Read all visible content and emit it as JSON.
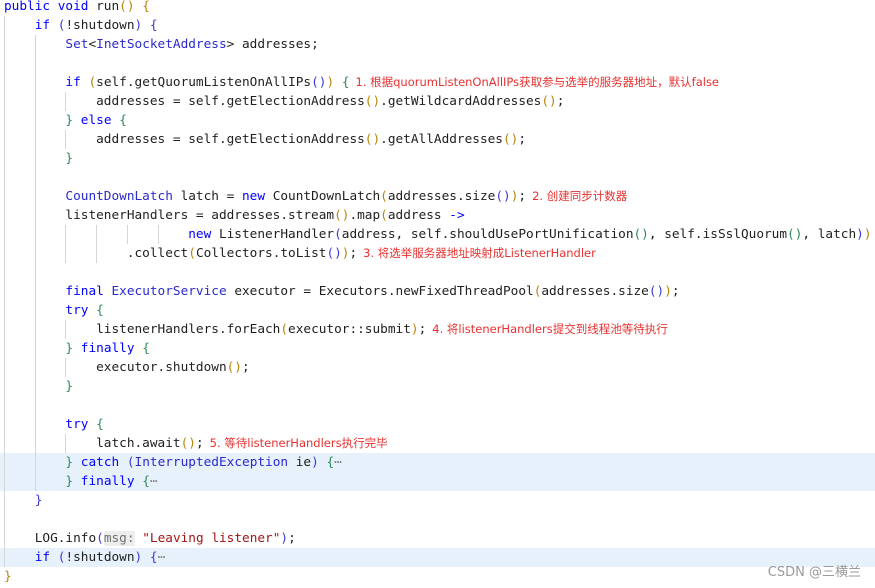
{
  "editor": {
    "lines": [
      {
        "indent": 0,
        "tokens": [
          [
            "public void ",
            "kw"
          ],
          [
            "run",
            "pl"
          ],
          [
            "()",
            "b1"
          ],
          [
            " ",
            "pl"
          ],
          [
            "{",
            "b1"
          ]
        ]
      },
      {
        "indent": 4,
        "tokens": [
          [
            "if ",
            "kw"
          ],
          [
            "(",
            "b2"
          ],
          [
            "!shutdown",
            "pl"
          ],
          [
            ")",
            "b2"
          ],
          [
            " ",
            "pl"
          ],
          [
            "{",
            "b2"
          ]
        ]
      },
      {
        "indent": 8,
        "tokens": [
          [
            "Set",
            "ty"
          ],
          [
            "<",
            "pl"
          ],
          [
            "InetSocketAddress",
            "ty"
          ],
          [
            "> addresses;",
            "pl"
          ]
        ]
      },
      {
        "indent": 0,
        "tokens": []
      },
      {
        "indent": 8,
        "tokens": [
          [
            "if ",
            "kw"
          ],
          [
            "(",
            "b1"
          ],
          [
            "self.getQuorumListenOnAllIPs",
            "pl"
          ],
          [
            "()",
            "b2"
          ],
          [
            ")",
            "b1"
          ],
          [
            " ",
            "pl"
          ],
          [
            "{",
            "b3"
          ]
        ],
        "comment": "1. 根据quorumListenOnAllIPs获取参与选举的服务器地址，默认false"
      },
      {
        "indent": 12,
        "tokens": [
          [
            "addresses = self.getElectionAddress",
            "pl"
          ],
          [
            "()",
            "b1"
          ],
          [
            ".getWildcardAddresses",
            "pl"
          ],
          [
            "()",
            "b1"
          ],
          [
            ";",
            "pl"
          ]
        ]
      },
      {
        "indent": 8,
        "tokens": [
          [
            "}",
            "b3"
          ],
          [
            " ",
            "pl"
          ],
          [
            "else ",
            "kw"
          ],
          [
            "{",
            "b3"
          ]
        ]
      },
      {
        "indent": 12,
        "tokens": [
          [
            "addresses = self.getElectionAddress",
            "pl"
          ],
          [
            "()",
            "b1"
          ],
          [
            ".getAllAddresses",
            "pl"
          ],
          [
            "()",
            "b1"
          ],
          [
            ";",
            "pl"
          ]
        ]
      },
      {
        "indent": 8,
        "tokens": [
          [
            "}",
            "b3"
          ]
        ]
      },
      {
        "indent": 0,
        "tokens": []
      },
      {
        "indent": 8,
        "tokens": [
          [
            "CountDownLatch",
            "ty"
          ],
          [
            " latch = ",
            "pl"
          ],
          [
            "new ",
            "kw"
          ],
          [
            "CountDownLatch",
            "pl"
          ],
          [
            "(",
            "b1"
          ],
          [
            "addresses.size",
            "pl"
          ],
          [
            "()",
            "b2"
          ],
          [
            ")",
            "b1"
          ],
          [
            ";",
            "pl"
          ]
        ],
        "comment": "2. 创建同步计数器"
      },
      {
        "indent": 8,
        "tokens": [
          [
            "listenerHandlers = addresses.stream",
            "pl"
          ],
          [
            "()",
            "b1"
          ],
          [
            ".map",
            "pl"
          ],
          [
            "(",
            "b1"
          ],
          [
            "address ",
            "pl"
          ],
          [
            "->",
            "kw"
          ]
        ]
      },
      {
        "indent": 24,
        "tokens": [
          [
            "new ",
            "kw"
          ],
          [
            "ListenerHandler",
            "pl"
          ],
          [
            "(",
            "b2"
          ],
          [
            "address, self.shouldUsePortUnification",
            "pl"
          ],
          [
            "()",
            "b3"
          ],
          [
            ", self.isSslQuorum",
            "pl"
          ],
          [
            "()",
            "b3"
          ],
          [
            ", latch",
            "pl"
          ],
          [
            ")",
            "b2"
          ],
          [
            ")",
            "b1"
          ]
        ]
      },
      {
        "indent": 16,
        "tokens": [
          [
            ".collect",
            "pl"
          ],
          [
            "(",
            "b1"
          ],
          [
            "Collectors.toList",
            "pl"
          ],
          [
            "()",
            "b2"
          ],
          [
            ")",
            "b1"
          ],
          [
            ";",
            "pl"
          ]
        ],
        "comment": "3. 将选举服务器地址映射成ListenerHandler"
      },
      {
        "indent": 0,
        "tokens": []
      },
      {
        "indent": 8,
        "tokens": [
          [
            "final ",
            "kw"
          ],
          [
            "ExecutorService",
            "ty"
          ],
          [
            " executor = Executors.newFixedThreadPool",
            "pl"
          ],
          [
            "(",
            "b1"
          ],
          [
            "addresses.size",
            "pl"
          ],
          [
            "()",
            "b2"
          ],
          [
            ")",
            "b1"
          ],
          [
            ";",
            "pl"
          ]
        ]
      },
      {
        "indent": 8,
        "tokens": [
          [
            "try ",
            "kw"
          ],
          [
            "{",
            "b3"
          ]
        ]
      },
      {
        "indent": 12,
        "tokens": [
          [
            "listenerHandlers.forEach",
            "pl"
          ],
          [
            "(",
            "b1"
          ],
          [
            "executor::submit",
            "pl"
          ],
          [
            ")",
            "b1"
          ],
          [
            ";",
            "pl"
          ]
        ],
        "comment": "4. 将listenerHandlers提交到线程池等待执行"
      },
      {
        "indent": 8,
        "tokens": [
          [
            "}",
            "b3"
          ],
          [
            " ",
            "pl"
          ],
          [
            "finally ",
            "kw"
          ],
          [
            "{",
            "b3"
          ]
        ]
      },
      {
        "indent": 12,
        "tokens": [
          [
            "executor.shutdown",
            "pl"
          ],
          [
            "()",
            "b1"
          ],
          [
            ";",
            "pl"
          ]
        ]
      },
      {
        "indent": 8,
        "tokens": [
          [
            "}",
            "b3"
          ]
        ]
      },
      {
        "indent": 0,
        "tokens": []
      },
      {
        "indent": 8,
        "tokens": [
          [
            "try ",
            "kw"
          ],
          [
            "{",
            "b3"
          ]
        ]
      },
      {
        "indent": 12,
        "tokens": [
          [
            "latch.await",
            "pl"
          ],
          [
            "()",
            "b1"
          ],
          [
            ";",
            "pl"
          ]
        ],
        "comment": "5. 等待listenerHandlers执行完毕"
      },
      {
        "indent": 8,
        "highlight": true,
        "tokens": [
          [
            "}",
            "b3"
          ],
          [
            " ",
            "pl"
          ],
          [
            "catch ",
            "kw"
          ],
          [
            "(",
            "b2"
          ],
          [
            "InterruptedException",
            "ty"
          ],
          [
            " ie",
            "pl"
          ],
          [
            ")",
            "b2"
          ],
          [
            " ",
            "pl"
          ],
          [
            "{",
            "b3"
          ],
          [
            "⋯",
            "fold"
          ]
        ]
      },
      {
        "indent": 8,
        "highlight": true,
        "tokens": [
          [
            "}",
            "b3"
          ],
          [
            " ",
            "pl"
          ],
          [
            "finally ",
            "kw"
          ],
          [
            "{",
            "b3"
          ],
          [
            "⋯",
            "fold"
          ]
        ]
      },
      {
        "indent": 4,
        "tokens": [
          [
            "}",
            "b2"
          ]
        ]
      },
      {
        "indent": 0,
        "tokens": []
      },
      {
        "indent": 4,
        "tokens": [
          [
            "LOG.info",
            "pl"
          ],
          [
            "(",
            "b2"
          ],
          [
            "msg:",
            "hint"
          ],
          [
            " ",
            "pl"
          ],
          [
            "\"Leaving listener\"",
            "st"
          ],
          [
            ")",
            "b2"
          ],
          [
            ";",
            "pl"
          ]
        ]
      },
      {
        "indent": 4,
        "highlight": true,
        "tokens": [
          [
            "if ",
            "kw"
          ],
          [
            "(",
            "b2"
          ],
          [
            "!shutdown",
            "pl"
          ],
          [
            ")",
            "b2"
          ],
          [
            " ",
            "pl"
          ],
          [
            "{",
            "b2"
          ],
          [
            "⋯",
            "fold"
          ]
        ]
      },
      {
        "indent": 0,
        "tokens": [
          [
            "}",
            "b1"
          ]
        ]
      }
    ]
  },
  "watermark": "CSDN @三横兰",
  "colors": {
    "keyword": "#0000ff",
    "comment": "#e8312f",
    "highlight": "#e6f1fc"
  }
}
